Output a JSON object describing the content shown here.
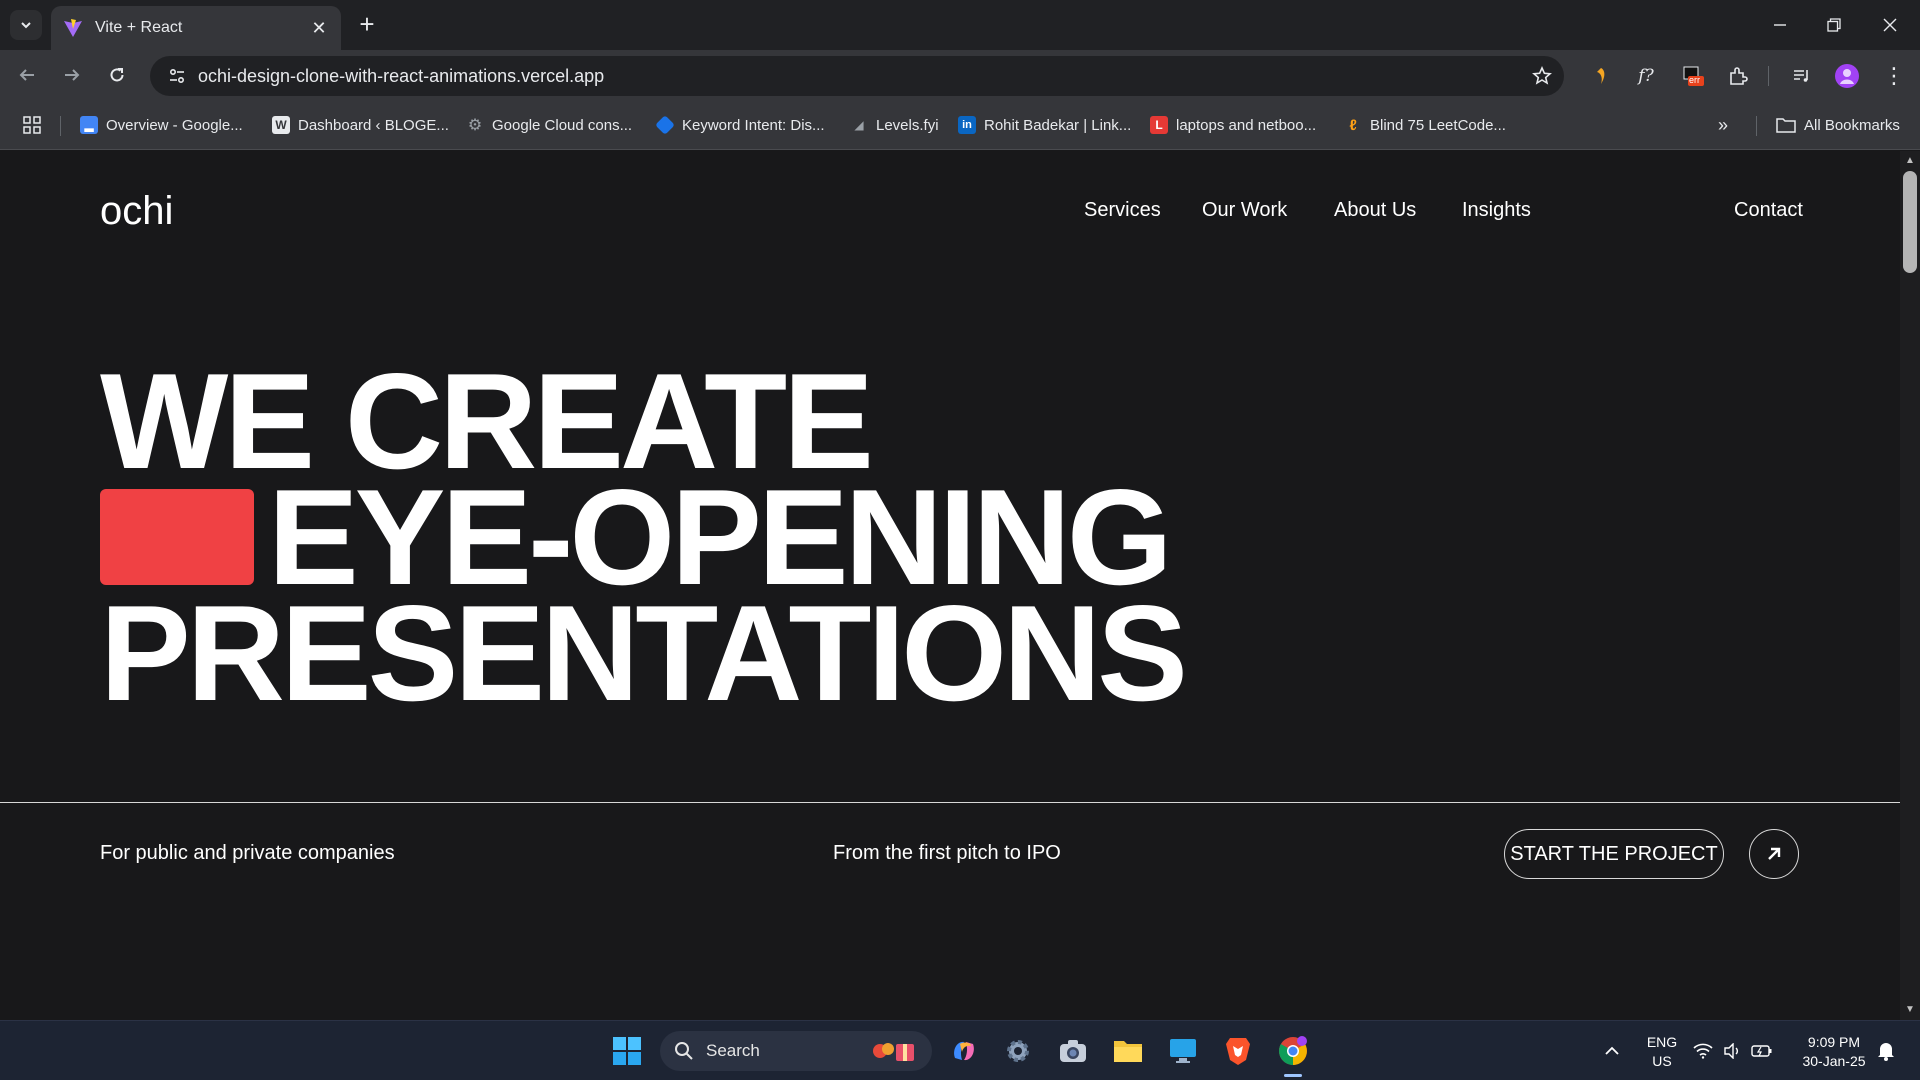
{
  "browser": {
    "tab_title": "Vite + React",
    "url": "ochi-design-clone-with-react-animations.vercel.app",
    "bookmarks": [
      {
        "label": "Overview - Google...",
        "color": "#4285f4"
      },
      {
        "label": "Dashboard ‹ BLOGE...",
        "color": "#e8eaed"
      },
      {
        "label": "Google Cloud cons...",
        "color": "#9aa0a6"
      },
      {
        "label": "Keyword Intent: Dis...",
        "color": "#1a73e8"
      },
      {
        "label": "Levels.fyi",
        "color": "#9aa0a6"
      },
      {
        "label": "Rohit Badekar | Link...",
        "color": "#0a66c2"
      },
      {
        "label": "laptops and netboo...",
        "color": "#e53935"
      },
      {
        "label": "Blind 75 LeetCode...",
        "color": "#ffa116"
      }
    ],
    "all_bookmarks": "All Bookmarks",
    "ext_badge": "err"
  },
  "site": {
    "logo": "ochi",
    "nav": [
      "Services",
      "Our Work",
      "About Us",
      "Insights"
    ],
    "contact": "Contact",
    "hero": [
      "WE CREATE",
      "EYE-OPENING",
      "PRESENTATIONS"
    ],
    "accent_color": "#f04144",
    "tagline_left": "For public and private companies",
    "tagline_mid": "From the first pitch to IPO",
    "cta": "START THE PROJECT"
  },
  "taskbar": {
    "search": "Search",
    "lang": "ENG",
    "region": "US",
    "time": "9:09 PM",
    "date": "30-Jan-25"
  }
}
